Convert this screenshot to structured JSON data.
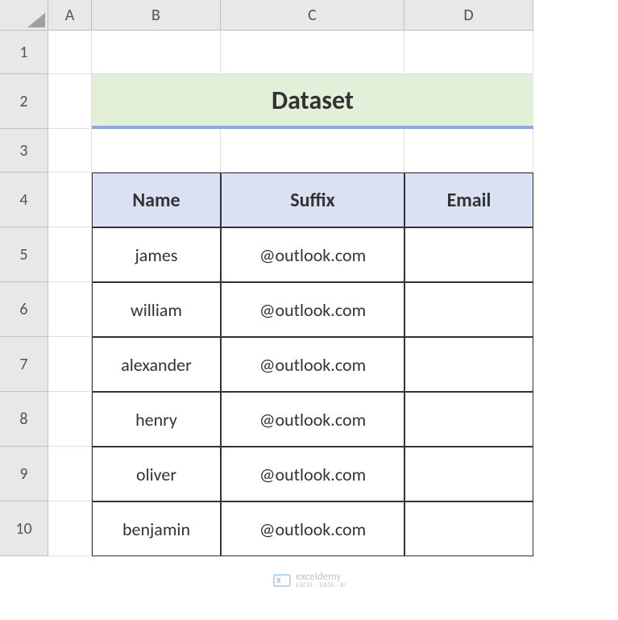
{
  "columns": [
    "A",
    "B",
    "C",
    "D"
  ],
  "rows": [
    "1",
    "2",
    "3",
    "4",
    "5",
    "6",
    "7",
    "8",
    "9",
    "10"
  ],
  "title": "Dataset",
  "headers": {
    "name": "Name",
    "suffix": "Suffix",
    "email": "Email"
  },
  "data": [
    {
      "name": "james",
      "suffix": "@outlook.com",
      "email": ""
    },
    {
      "name": "william",
      "suffix": "@outlook.com",
      "email": ""
    },
    {
      "name": "alexander",
      "suffix": "@outlook.com",
      "email": ""
    },
    {
      "name": "henry",
      "suffix": "@outlook.com",
      "email": ""
    },
    {
      "name": "oliver",
      "suffix": "@outlook.com",
      "email": ""
    },
    {
      "name": "benjamin",
      "suffix": "@outlook.com",
      "email": ""
    }
  ],
  "watermark": {
    "brand": "exceldemy",
    "tagline": "EXCEL · DATA · BI"
  },
  "chart_data": {
    "type": "table",
    "title": "Dataset",
    "columns": [
      "Name",
      "Suffix",
      "Email"
    ],
    "rows": [
      [
        "james",
        "@outlook.com",
        ""
      ],
      [
        "william",
        "@outlook.com",
        ""
      ],
      [
        "alexander",
        "@outlook.com",
        ""
      ],
      [
        "henry",
        "@outlook.com",
        ""
      ],
      [
        "oliver",
        "@outlook.com",
        ""
      ],
      [
        "benjamin",
        "@outlook.com",
        ""
      ]
    ]
  }
}
